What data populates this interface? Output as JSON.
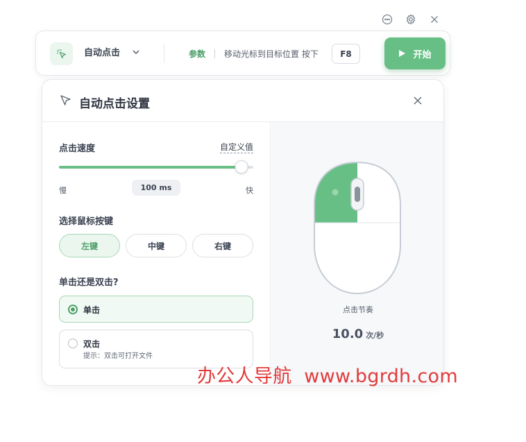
{
  "window": {
    "controls": [
      {
        "name": "chat-icon"
      },
      {
        "name": "settings-icon"
      },
      {
        "name": "close-icon"
      }
    ]
  },
  "toolbar": {
    "app_icon": "cursor-click-icon",
    "mode_label": "自动点击",
    "param_label": "参数",
    "hint": "移动光标到目标位置 按下",
    "hotkey": "F8",
    "start_label": "开始",
    "accent_color": "#67bf85"
  },
  "panel": {
    "title": "自动点击设置",
    "speed": {
      "label": "点击速度",
      "custom_link": "自定义值",
      "slow_label": "慢",
      "fast_label": "快",
      "value_text": "100 ms",
      "slider_fraction": 0.94
    },
    "mouse_button": {
      "label": "选择鼠标按键",
      "options": [
        "左键",
        "中键",
        "右键"
      ],
      "selected": "左键"
    },
    "click_type": {
      "label": "单击还是双击?",
      "options": [
        {
          "title": "单击",
          "sub": "",
          "selected": true
        },
        {
          "title": "双击",
          "sub": "提示：双击可打开文件",
          "selected": false
        }
      ]
    },
    "preview": {
      "rhythm_label": "点击节奏",
      "rate_value": "10.0",
      "rate_unit": "次/秒"
    }
  },
  "watermark": "办公人导航  www.bgrdh.com"
}
